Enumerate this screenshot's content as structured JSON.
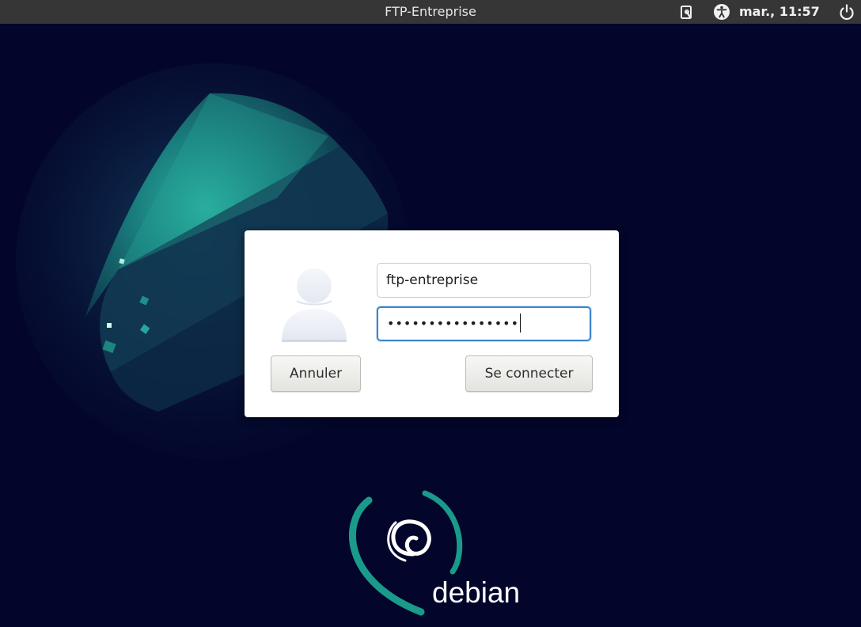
{
  "panel": {
    "title": "FTP-Entreprise",
    "clock": "mar., 11:57",
    "icons": [
      "screen-capture-icon",
      "accessibility-icon",
      "power-icon"
    ]
  },
  "login": {
    "username_value": "ftp-entreprise",
    "password_mask": "••••••••••••••••",
    "cancel_label": "Annuler",
    "connect_label": "Se connecter",
    "avatar_icon": "user-avatar-icon"
  },
  "branding": {
    "logo_text": "debian",
    "accent_color": "#1a9a8a",
    "background_color": "#03062a"
  }
}
